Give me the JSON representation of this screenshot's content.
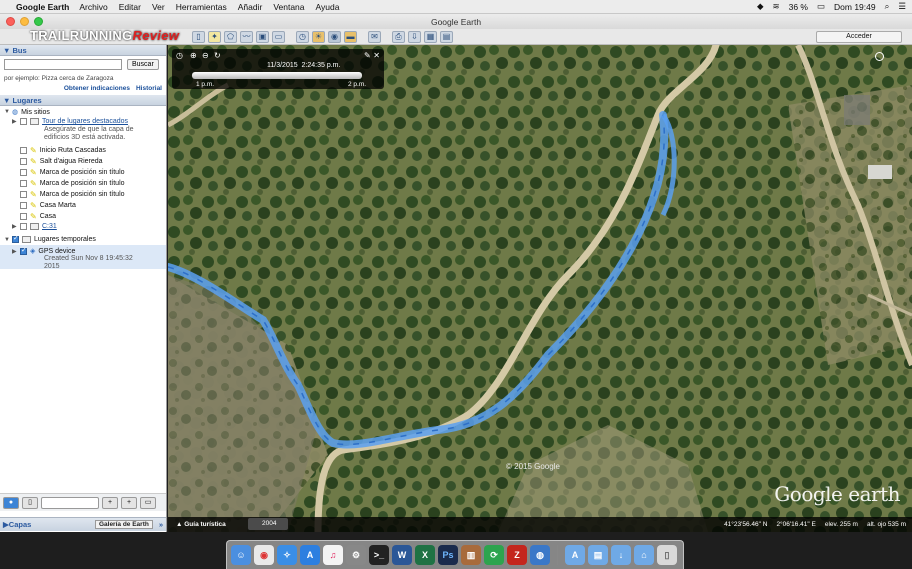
{
  "menubar": {
    "app_name": "Google Earth",
    "menus": [
      "Archivo",
      "Editar",
      "Ver",
      "Herramientas",
      "Añadir",
      "Ventana",
      "Ayuda"
    ],
    "battery": "36 %",
    "clock": "Dom 19:49"
  },
  "window": {
    "title": "Google Earth"
  },
  "toolbar": {
    "sign_in_label": "Acceder"
  },
  "watermark": {
    "brand": "TRAILRUNNING",
    "brand_accent": "Review"
  },
  "search": {
    "header": "Bus",
    "placeholder": "",
    "button_label": "Buscar",
    "hint": "por ejemplo: Pizza cerca de Zaragoza",
    "directions_link": "Obtener indicaciones",
    "history_link": "Historial"
  },
  "places": {
    "header": "Lugares",
    "my_places": "Mis sitios",
    "tour_link": "Tour de lugares destacados",
    "tour_note_1": "Asegúrate de que la capa de",
    "tour_note_2": "edificios 3D está activada.",
    "items": [
      "Inicio Ruta Cascadas",
      "Salt d'aigua Riereda",
      "Marca de posición sin título",
      "Marca de posición sin título",
      "Marca de posición sin título",
      "Casa Marta",
      "Casa"
    ],
    "drive_link": "C:31",
    "temp_places": "Lugares temporales",
    "gps_device": "GPS device",
    "gps_created_1": "Created Sun Nov 8 19:45:32",
    "gps_created_2": "2015"
  },
  "layers": {
    "header": "Capas",
    "gallery_button": "Galería de Earth"
  },
  "map": {
    "time_slider": {
      "date": "11/3/2015",
      "time": "2:24:35 p.m.",
      "start": "1 p.m.",
      "end": "2 p.m."
    },
    "copyright": "© 2015 Google",
    "logo": "Google earth",
    "tour_guide": "Guía turística",
    "year_tab": "2004",
    "lat": "41°23'56.46\" N",
    "lon": "2°06'16.41\" E",
    "elevation": "elev. 255 m",
    "eye_alt": "alt. ojo 535 m"
  },
  "colors": {
    "track": "#5aa0f0",
    "track_edge": "#2d6fc7",
    "accent": "#2c5aa0"
  }
}
